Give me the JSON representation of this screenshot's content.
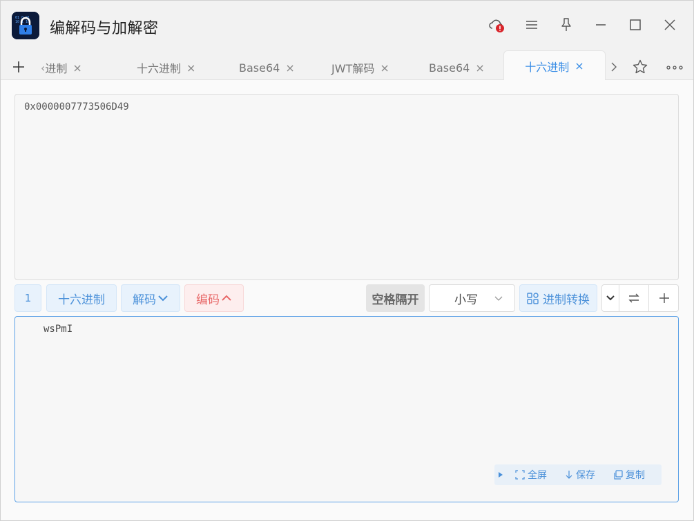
{
  "app": {
    "title": "编解码与加解密"
  },
  "tabs": [
    {
      "label": "进制",
      "prefix": "‹ ",
      "close": "×"
    },
    {
      "label": "十六进制",
      "close": "×"
    },
    {
      "label": "Base64",
      "close": "×"
    },
    {
      "label": "JWT解码",
      "close": "×"
    },
    {
      "label": "Base64",
      "close": "×"
    },
    {
      "label": "十六进制",
      "close": "×",
      "active": true
    }
  ],
  "input": {
    "value": "0x0000007773506D49"
  },
  "toolbar": {
    "line_count": "1",
    "mode_label": "十六进制",
    "decode_label": "解码",
    "encode_label": "编码",
    "space_label": "空格隔开",
    "case_value": "小写",
    "convert_label": "进制转换"
  },
  "output": {
    "value": "wsPmI"
  },
  "output_actions": {
    "fullscreen_label": "全屏",
    "save_label": "保存",
    "copy_label": "复制"
  },
  "colors": {
    "accent": "#3a8ee6",
    "danger": "#e86868",
    "badge": "#d9252b"
  },
  "icons": [
    "app-lock-icon",
    "cloud-alert-icon",
    "menu-icon",
    "pin-icon",
    "minimize-icon",
    "maximize-icon",
    "close-icon",
    "add-tab-icon",
    "chevron-right-icon",
    "star-icon",
    "more-icon",
    "grid-icon",
    "chevron-down-icon",
    "swap-icon",
    "plus-icon",
    "fullscreen-icon",
    "download-icon",
    "copy-icon"
  ]
}
